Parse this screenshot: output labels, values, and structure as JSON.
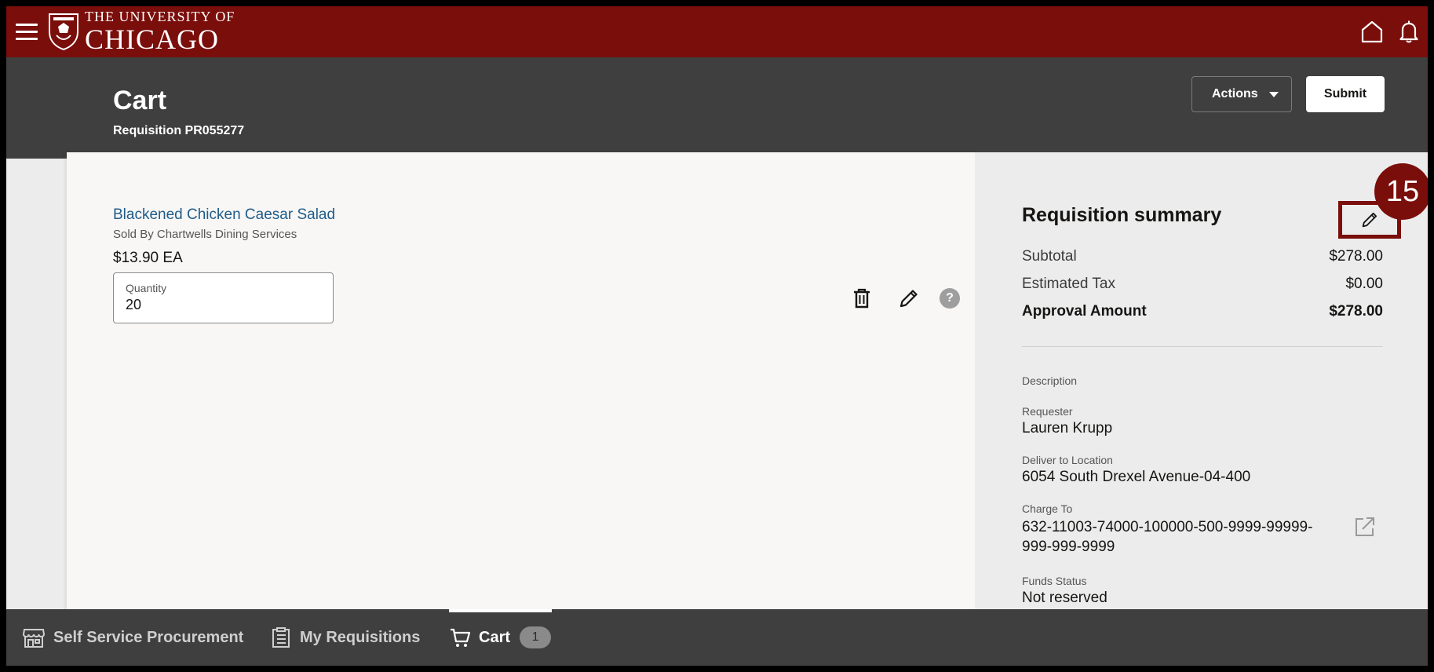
{
  "brand": {
    "line1": "THE UNIVERSITY OF",
    "line2": "CHICAGO",
    "color": "#7a0e0b"
  },
  "topbar": {
    "icons": [
      "hamburger-menu-icon",
      "home-icon",
      "bell-icon"
    ]
  },
  "header": {
    "title": "Cart",
    "subtitle": "Requisition PR055277",
    "actions_label": "Actions",
    "submit_label": "Submit"
  },
  "item": {
    "title": "Blackened Chicken Caesar Salad",
    "seller": "Sold By Chartwells Dining Services",
    "price": "$13.90 EA",
    "quantity_label": "Quantity",
    "quantity_value": "20",
    "help_glyph": "?"
  },
  "summary": {
    "title": "Requisition summary",
    "step_badge": "15",
    "subtotal_label": "Subtotal",
    "subtotal_value": "$278.00",
    "tax_label": "Estimated Tax",
    "tax_value": "$0.00",
    "approval_label": "Approval Amount",
    "approval_value": "$278.00",
    "description_label": "Description",
    "requester_label": "Requester",
    "requester_value": "Lauren Krupp",
    "deliver_label": "Deliver to Location",
    "deliver_value": "6054 South Drexel Avenue-04-400",
    "charge_label": "Charge To",
    "charge_value": "632-11003-74000-100000-500-9999-99999-999-999-9999",
    "funds_label": "Funds Status",
    "funds_value": "Not reserved"
  },
  "bottomnav": {
    "procurement_label": "Self Service Procurement",
    "requisitions_label": "My Requisitions",
    "cart_label": "Cart",
    "cart_count": "1"
  }
}
